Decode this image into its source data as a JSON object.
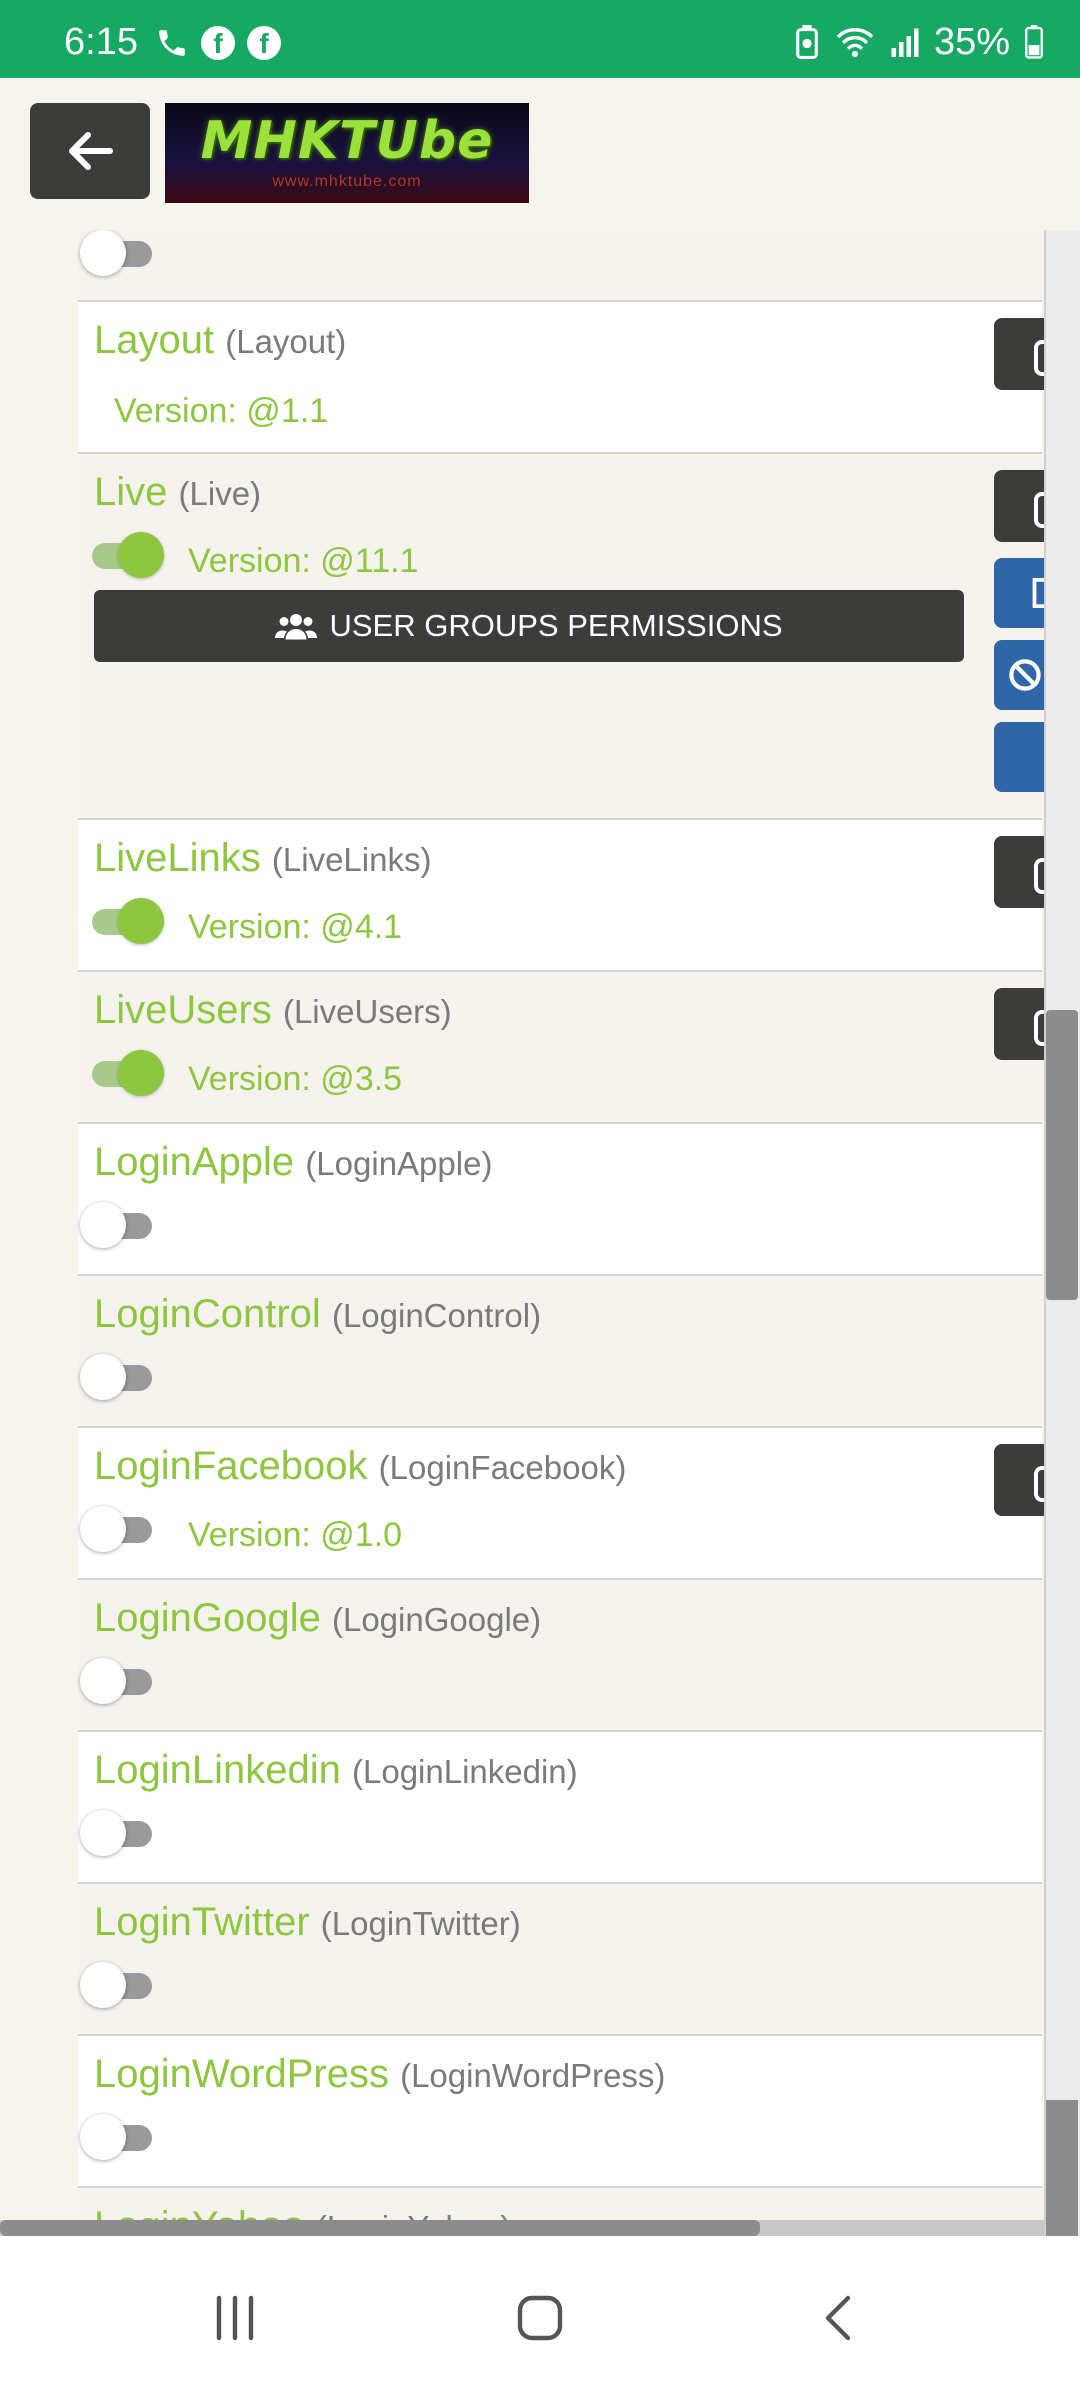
{
  "status_bar": {
    "time": "6:15",
    "battery": "35%",
    "icons_left": [
      "phone-icon",
      "facebook-icon",
      "facebook-icon"
    ],
    "icons_right": [
      "recycle-icon",
      "wifi-icon",
      "signal-icon",
      "battery-icon"
    ]
  },
  "header": {
    "back_icon": "arrow-left-icon",
    "logo_text": "MHKTUbe",
    "logo_sub": "www.mhktube.com"
  },
  "list": {
    "rows": [
      {
        "name": "",
        "sub": "",
        "enabled": false,
        "version": ""
      },
      {
        "name": "Layout",
        "sub": "(Layout)",
        "enabled": null,
        "version": "Version: @1.1"
      },
      {
        "name": "Live",
        "sub": "(Live)",
        "enabled": true,
        "version": "Version: @11.1",
        "button": "USER GROUPS PERMISSIONS"
      },
      {
        "name": "LiveLinks",
        "sub": "(LiveLinks)",
        "enabled": true,
        "version": "Version: @4.1"
      },
      {
        "name": "LiveUsers",
        "sub": "(LiveUsers)",
        "enabled": true,
        "version": "Version: @3.5"
      },
      {
        "name": "LoginApple",
        "sub": "(LoginApple)",
        "enabled": false,
        "version": ""
      },
      {
        "name": "LoginControl",
        "sub": "(LoginControl)",
        "enabled": false,
        "version": ""
      },
      {
        "name": "LoginFacebook",
        "sub": "(LoginFacebook)",
        "enabled": false,
        "version": "Version: @1.0"
      },
      {
        "name": "LoginGoogle",
        "sub": "(LoginGoogle)",
        "enabled": false,
        "version": ""
      },
      {
        "name": "LoginLinkedin",
        "sub": "(LoginLinkedin)",
        "enabled": false,
        "version": ""
      },
      {
        "name": "LoginTwitter",
        "sub": "(LoginTwitter)",
        "enabled": false,
        "version": ""
      },
      {
        "name": "LoginWordPress",
        "sub": "(LoginWordPress)",
        "enabled": false,
        "version": ""
      },
      {
        "name": "LoginYahoo",
        "sub": "(LoginYahoo)",
        "enabled": false,
        "version": ""
      }
    ]
  },
  "nav_bar": {
    "buttons": [
      "recent-apps-icon",
      "home-icon",
      "back-icon"
    ]
  },
  "colors": {
    "status_bar": "#17a864",
    "accent_green": "#8dc63f",
    "dark_button": "#3c3c3a",
    "blue_button": "#2f66a8"
  }
}
